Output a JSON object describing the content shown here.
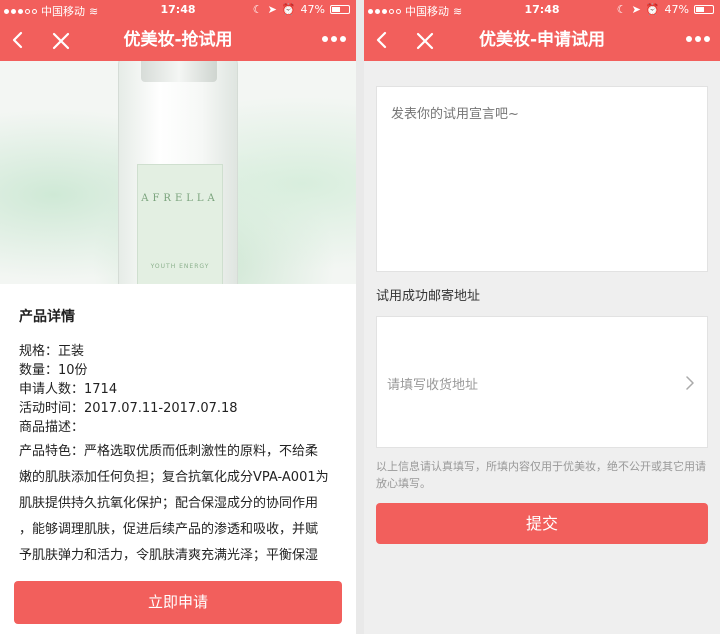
{
  "status_bar": {
    "carrier": "中国移动",
    "time": "17:48",
    "battery": "47%",
    "battery_level": 0.47
  },
  "left_screen": {
    "title": "优美妆-抢试用",
    "product_image": {
      "brand": "AFRELLA",
      "sub_brand": "YOUTH ENERGY"
    },
    "details": {
      "heading": "产品详情",
      "spec": "规格：正装",
      "quantity": "数量：10份",
      "applicants": "申请人数：1714",
      "period": "活动时间：2017.07.11-2017.07.18",
      "desc_label": "商品描述：",
      "desc_lines": [
        "产品特色：严格选取优质而低刺激性的原料，不给柔",
        "嫩的肌肤添加任何负担；复合抗氧化成分VPA-A001为",
        "肌肤提供持久抗氧化保护；配合保湿成分的协同作用",
        "，能够调理肌肤，促进后续产品的渗透和吸收，并赋",
        "予肌肤弹力和活力，令肌肤清爽充满光泽；平衡保湿"
      ]
    },
    "apply_button": "立即申请"
  },
  "right_screen": {
    "title": "优美妆-申请试用",
    "declaration_placeholder": "发表你的试用宣言吧~",
    "address_label": "试用成功邮寄地址",
    "address_placeholder": "请填写收货地址",
    "hint": "以上信息请认真填写，所填内容仅用于优美妆，绝不公开或其它用请放心填写。",
    "submit_button": "提交"
  },
  "colors": {
    "accent": "#f25f5c"
  }
}
